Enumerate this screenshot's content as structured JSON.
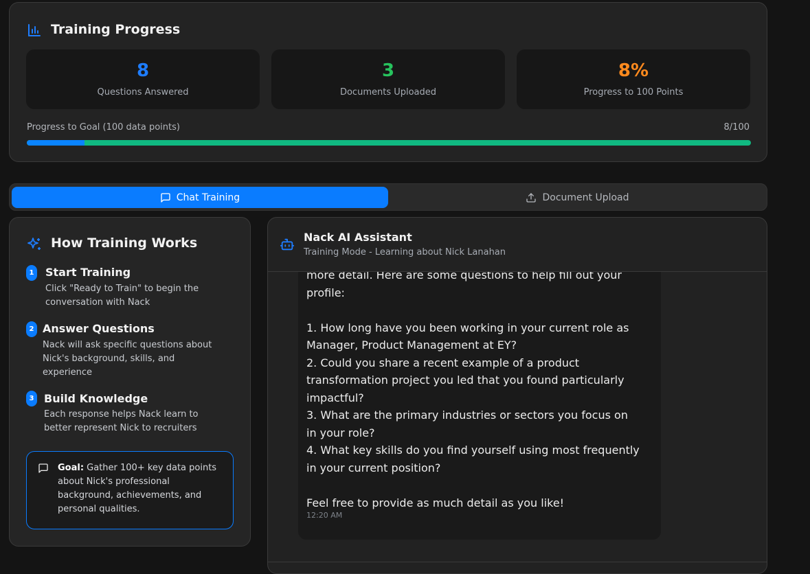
{
  "progress": {
    "title": "Training Progress",
    "stats": [
      {
        "value": "8",
        "label": "Questions Answered",
        "color": "#1e7dff"
      },
      {
        "value": "3",
        "label": "Documents Uploaded",
        "color": "#27c25d"
      },
      {
        "value": "8%",
        "label": "Progress to 100 Points",
        "color": "#ff8a1e"
      }
    ],
    "goal_label": "Progress to Goal (100 data points)",
    "goal_count": "8/100",
    "progress_fraction": 0.08
  },
  "tabs": {
    "chat": "Chat Training",
    "upload": "Document Upload"
  },
  "how": {
    "title": "How Training Works",
    "steps": [
      {
        "num": "1",
        "title": "Start Training",
        "desc": [
          "Click \"Ready to Train\" to begin the",
          "conversation with Nack"
        ]
      },
      {
        "num": "2",
        "title": "Answer Questions",
        "desc": [
          "Nack will ask specific questions about",
          "Nick's background, skills, and",
          "experience"
        ]
      },
      {
        "num": "3",
        "title": "Build Knowledge",
        "desc": [
          "Each response helps Nack learn to",
          "better represent Nick to recruiters"
        ]
      }
    ],
    "goal_bold": "Goal:",
    "goal_lines": [
      " Gather 100+ key data points",
      "about Nick's professional",
      "background, achievements, and",
      "personal qualities."
    ]
  },
  "chat": {
    "assistant_name": "Nack AI Assistant",
    "assistant_sub": "Training Mode - Learning about Nick Lanahan",
    "message_lines": [
      "more detail. Here are some questions to help fill out your",
      "profile:",
      "",
      "1. How long have you been working in your current role as",
      "Manager, Product Management at EY?",
      "2. Could you share a recent example of a product",
      "transformation project you led that you found particularly",
      "impactful?",
      "3. What are the primary industries or sectors you focus on",
      "in your role?",
      "4. What key skills do you find yourself using most frequently",
      "in your current position?",
      "",
      "Feel free to provide as much detail as you like!"
    ],
    "time": "12:20 AM"
  }
}
